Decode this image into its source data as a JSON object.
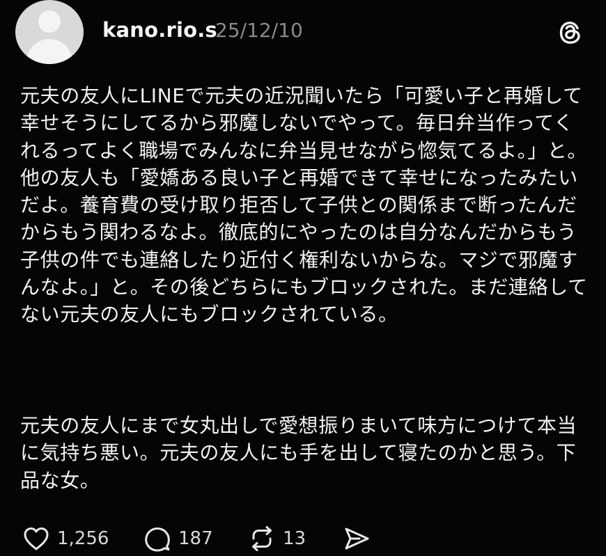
{
  "post": {
    "username": "kano.rio.s",
    "date": "25/12/10",
    "paragraphs": [
      "元夫の友人にLINEで元夫の近況聞いたら「可愛い子と再婚して幸せそうにしてるから邪魔しないでやって。毎日弁当作ってくれるってよく職場でみんなに弁当見せながら惚気てるよ。」と。他の友人も「愛嬌ある良い子と再婚できて幸せになったみたいだよ。養育費の受け取り拒否して子供との関係まで断ったんだからもう関わるなよ。徹底的にやったのは自分なんだからもう子供の件でも連絡したり近付く権利ないからな。マジで邪魔すんなよ。」と。その後どちらにもブロックされた。まだ連絡してない元夫の友人にもブロックされている。",
      "元夫の友人にまで女丸出しで愛想振りまいて味方につけて本当に気持ち悪い。元夫の友人にも手を出して寝たのかと思う。下品な女。"
    ]
  },
  "actions": {
    "like_count": "1,256",
    "reply_count": "187",
    "repost_count": "13"
  },
  "icons": {
    "avatar": "default-avatar-icon",
    "brand": "threads-logo-icon",
    "like": "heart-icon",
    "reply": "comment-bubble-icon",
    "repost": "repost-arrows-icon",
    "share": "send-icon"
  },
  "colors": {
    "background": "#050505",
    "text": "#f2f2f2",
    "muted": "#8a8a8a"
  }
}
